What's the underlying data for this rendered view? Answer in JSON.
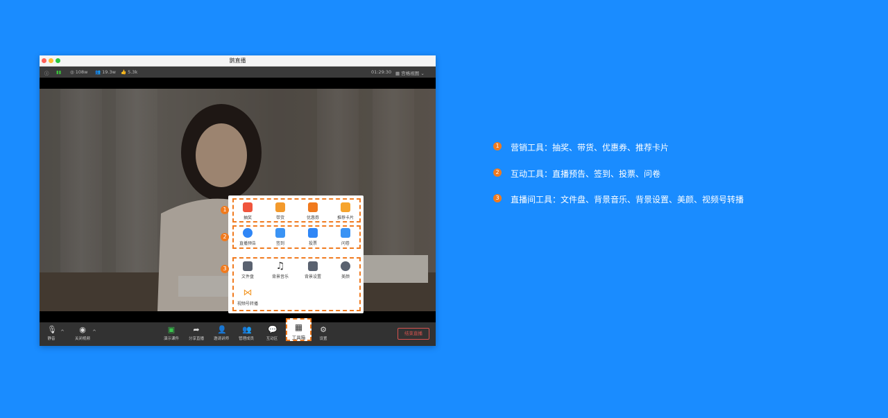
{
  "window": {
    "title": "鹅直播",
    "info": {
      "viewers": "108w",
      "online": "19.3w",
      "likes": "5.3k",
      "timer": "01:29:30",
      "layout": "宫格视图"
    }
  },
  "bottombar": {
    "mute": "静音",
    "camera": "关闭视频",
    "present": "演示课件",
    "share": "分享直播",
    "invite": "邀请讲师",
    "members": "管理成员",
    "interact": "互动区",
    "toolbox": "工具箱",
    "settings": "设置",
    "end": "结束直播"
  },
  "toolbox": {
    "marketing": [
      "抽奖",
      "带货",
      "优惠券",
      "推荐卡片"
    ],
    "interaction": [
      "直播预告",
      "签到",
      "投票",
      "问卷"
    ],
    "room": [
      "文件盘",
      "背景音乐",
      "背景设置",
      "美颜",
      "视频号转播"
    ]
  },
  "legend": [
    {
      "num": "1",
      "text": "营销工具：抽奖、带货、优惠券、推荐卡片"
    },
    {
      "num": "2",
      "text": "互动工具：直播预告、签到、投票、问卷"
    },
    {
      "num": "3",
      "text": "直播间工具：文件盘、背景音乐、背景设置、美颜、视频号转播"
    }
  ],
  "colors": {
    "background": "#1a8cff",
    "accent": "#f07a1e"
  }
}
